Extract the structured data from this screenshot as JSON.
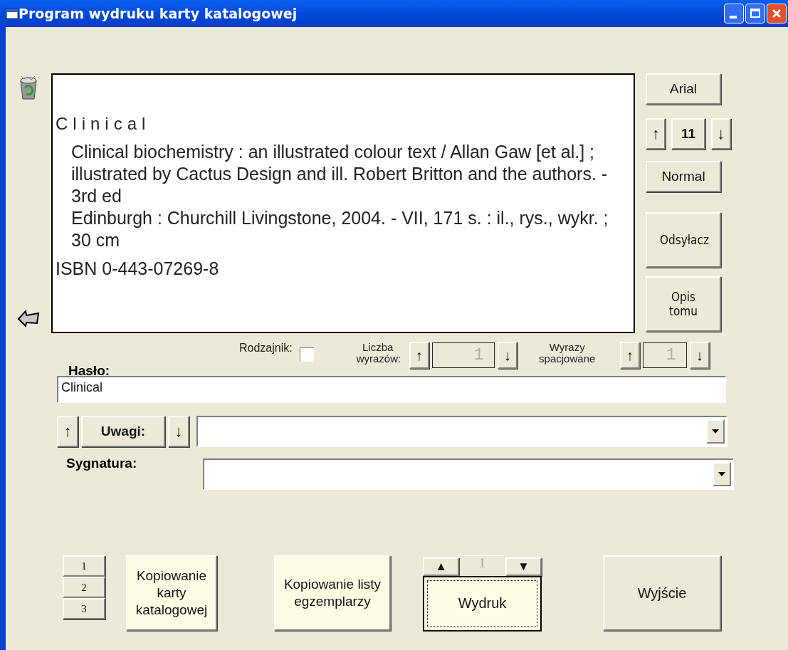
{
  "window": {
    "title": "Program wydruku karty katalogowej"
  },
  "preview": {
    "heading": "Clinical",
    "paragraphs": [
      "Clinical biochemistry : an illustrated colour text / Allan Gaw [et al.] ; illustrated by Cactus Design and ill. Robert Britton and the authors. - 3rd ed",
      "Edinburgh : Churchill Livingstone, 2004. - VII, 171 s. : il., rys., wykr. ; 30 cm"
    ],
    "isbn": "ISBN 0-443-07269-8"
  },
  "font_panel": {
    "font": "Arial",
    "up": "↑",
    "size": "11",
    "down": "↓",
    "style": "Normal"
  },
  "side_buttons": [
    "Odsyłacz",
    "Opis tomu"
  ],
  "options": {
    "article_label": "Rodzajnik:",
    "article_checked": false,
    "word_count": {
      "label": "Liczba wyrazów:",
      "up": "↑",
      "value": "1",
      "down": "↓",
      "disabled": true
    },
    "spaced_words": {
      "label": "Wyrazy spacjowane",
      "up": "↑",
      "value": "1",
      "down": "↓",
      "disabled": true
    }
  },
  "entry": {
    "label": "Hasło:",
    "value": "Clinical"
  },
  "notes": {
    "up": "↑",
    "button": "Uwagi:",
    "down": "↓"
  },
  "signature": {
    "label": "Sygnatura:"
  },
  "copies": [
    "1",
    "2",
    "3"
  ],
  "actions": [
    {
      "label": "Kopiowanie karty katalogowej"
    },
    {
      "label": "Kopiowanie listy egzemplarzy"
    }
  ],
  "print": {
    "up": "▲",
    "count": "1",
    "down": "▼",
    "count_disabled": true,
    "button": "Wydruk",
    "focused": true
  },
  "exit": {
    "label": "Wyjście"
  }
}
